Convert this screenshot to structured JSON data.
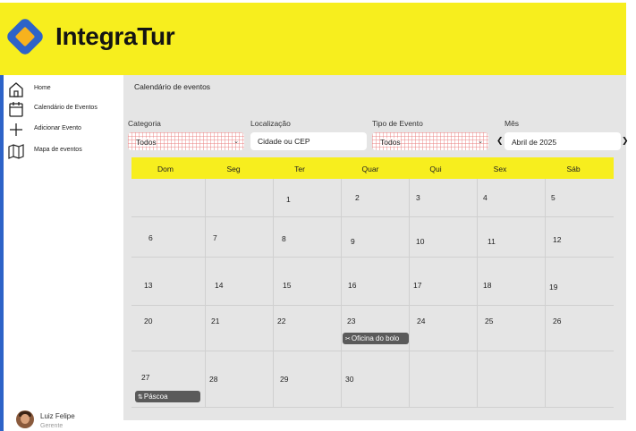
{
  "app": {
    "name": "IntegraTur",
    "brand_color": "#f7ee1e",
    "logo_colors": [
      "#2d63c8",
      "#f7b21e"
    ]
  },
  "sidebar": {
    "items": [
      {
        "label": "Home",
        "icon": "home-icon"
      },
      {
        "label": "Calendário de Eventos",
        "icon": "calendar-icon"
      },
      {
        "label": "Adicionar Evento",
        "icon": "plus-icon"
      },
      {
        "label": "Mapa de eventos",
        "icon": "map-icon"
      }
    ],
    "accent_color": "#2d63c8"
  },
  "user": {
    "name": "Luiz Felipe",
    "role": "Gerente"
  },
  "page": {
    "title": "Calendário de eventos"
  },
  "filters": {
    "category": {
      "label": "Categoria",
      "value": "Todos"
    },
    "location": {
      "label": "Localização",
      "placeholder": "Cidade ou CEP"
    },
    "event_type": {
      "label": "Tipo de Evento",
      "value": "Todos"
    },
    "month": {
      "label": "Mês",
      "value": "Abril de 2025",
      "prev_icon": "chevron-left-icon",
      "next_icon": "chevron-right-icon"
    }
  },
  "calendar": {
    "weekdays": [
      "Dom",
      "Seg",
      "Ter",
      "Quar",
      "Qui",
      "Sex",
      "Sáb"
    ],
    "weeks": [
      [
        "",
        "",
        "1",
        "2",
        "3",
        "4",
        "5"
      ],
      [
        "6",
        "7",
        "8",
        "9",
        "10",
        "11",
        "12"
      ],
      [
        "13",
        "14",
        "15",
        "16",
        "17",
        "18",
        "19"
      ],
      [
        "20",
        "21",
        "22",
        "23",
        "24",
        "25",
        "26"
      ],
      [
        "27",
        "28",
        "29",
        "30",
        "",
        "",
        ""
      ]
    ],
    "events": [
      {
        "day": "23",
        "label": "Oficina do bolo",
        "icon": "scissors-icon",
        "icon_glyph": "✂"
      },
      {
        "day": "27",
        "label": "Páscoa",
        "icon": "swap-icon",
        "icon_glyph": "⇅"
      }
    ]
  }
}
